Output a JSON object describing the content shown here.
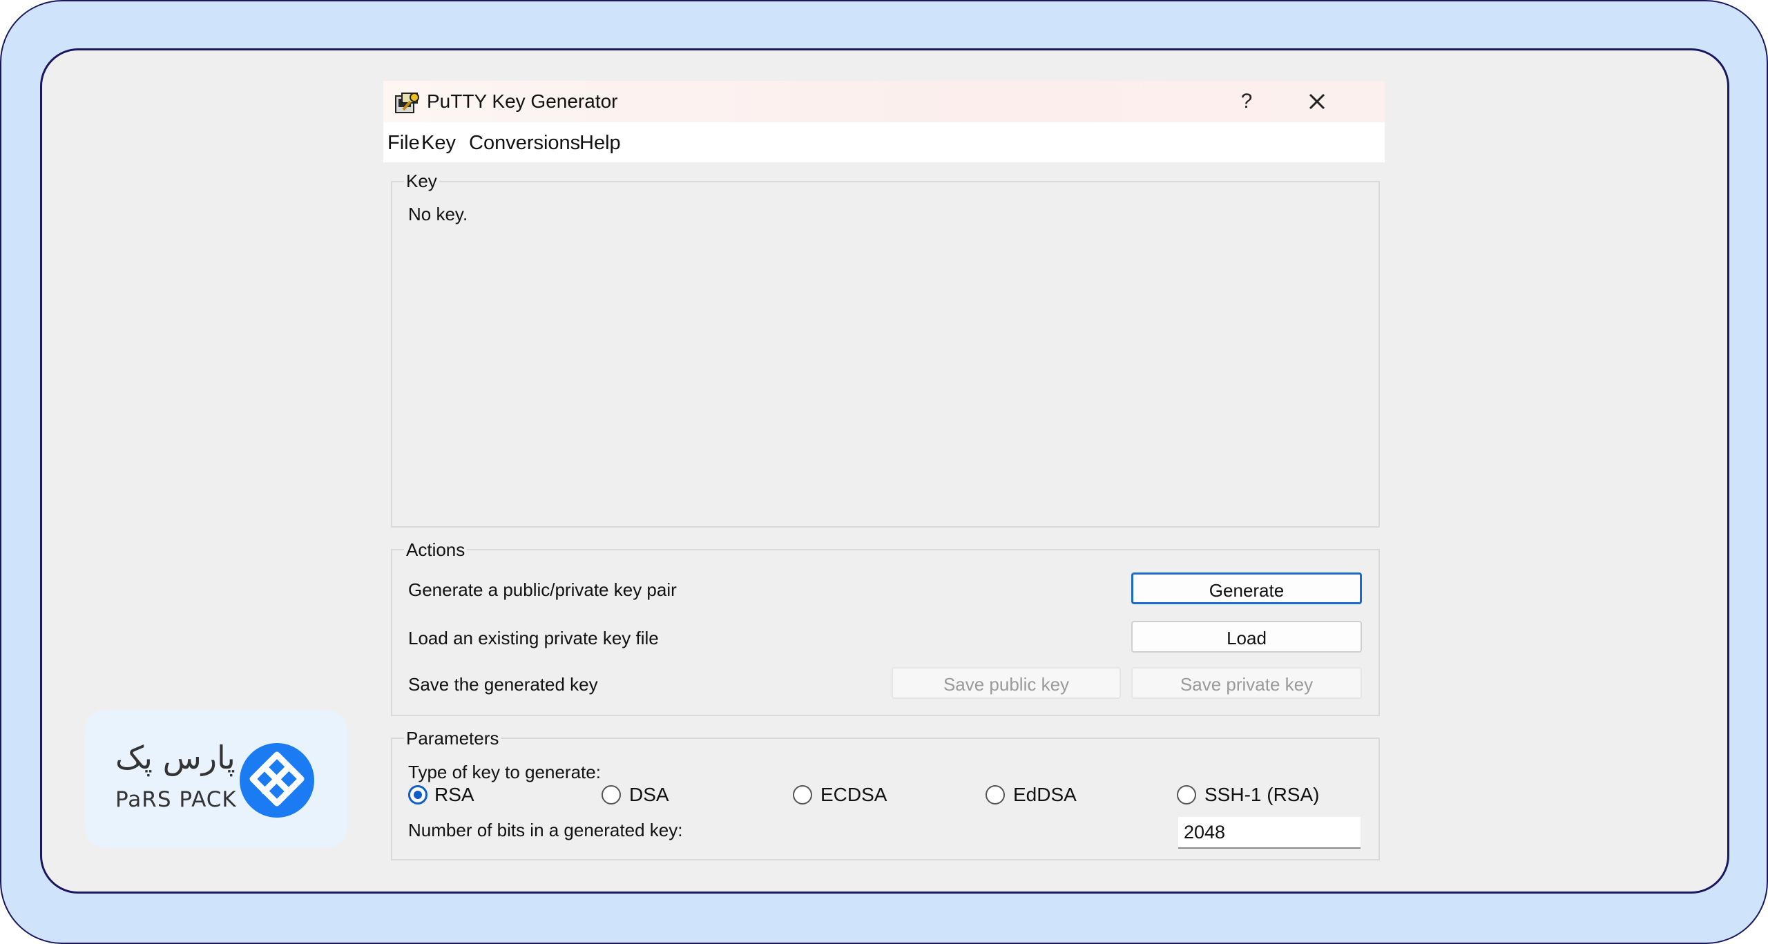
{
  "window": {
    "title": "PuTTY Key Generator",
    "help_label": "?"
  },
  "menu": [
    "File",
    "Key",
    "Conversions",
    "Help"
  ],
  "key_group": {
    "label": "Key",
    "status": "No key."
  },
  "actions": {
    "label": "Actions",
    "generate_desc": "Generate a public/private key pair",
    "generate_btn": "Generate",
    "load_desc": "Load an existing private key file",
    "load_btn": "Load",
    "save_desc": "Save the generated key",
    "save_public_btn": "Save public key",
    "save_private_btn": "Save private key"
  },
  "parameters": {
    "label": "Parameters",
    "type_label": "Type of key to generate:",
    "key_types": [
      "RSA",
      "DSA",
      "ECDSA",
      "EdDSA",
      "SSH-1 (RSA)"
    ],
    "selected_type": "RSA",
    "bits_label": "Number of bits in a generated key:",
    "bits_value": "2048"
  },
  "logo": {
    "persian_text": "پارس پک",
    "latin_text": "PaRS PACK",
    "color": "#1a7bf2"
  },
  "colors": {
    "frame_border": "#1b1660",
    "frame_bg": "#cfe4fb",
    "accent": "#1c6ac9"
  }
}
